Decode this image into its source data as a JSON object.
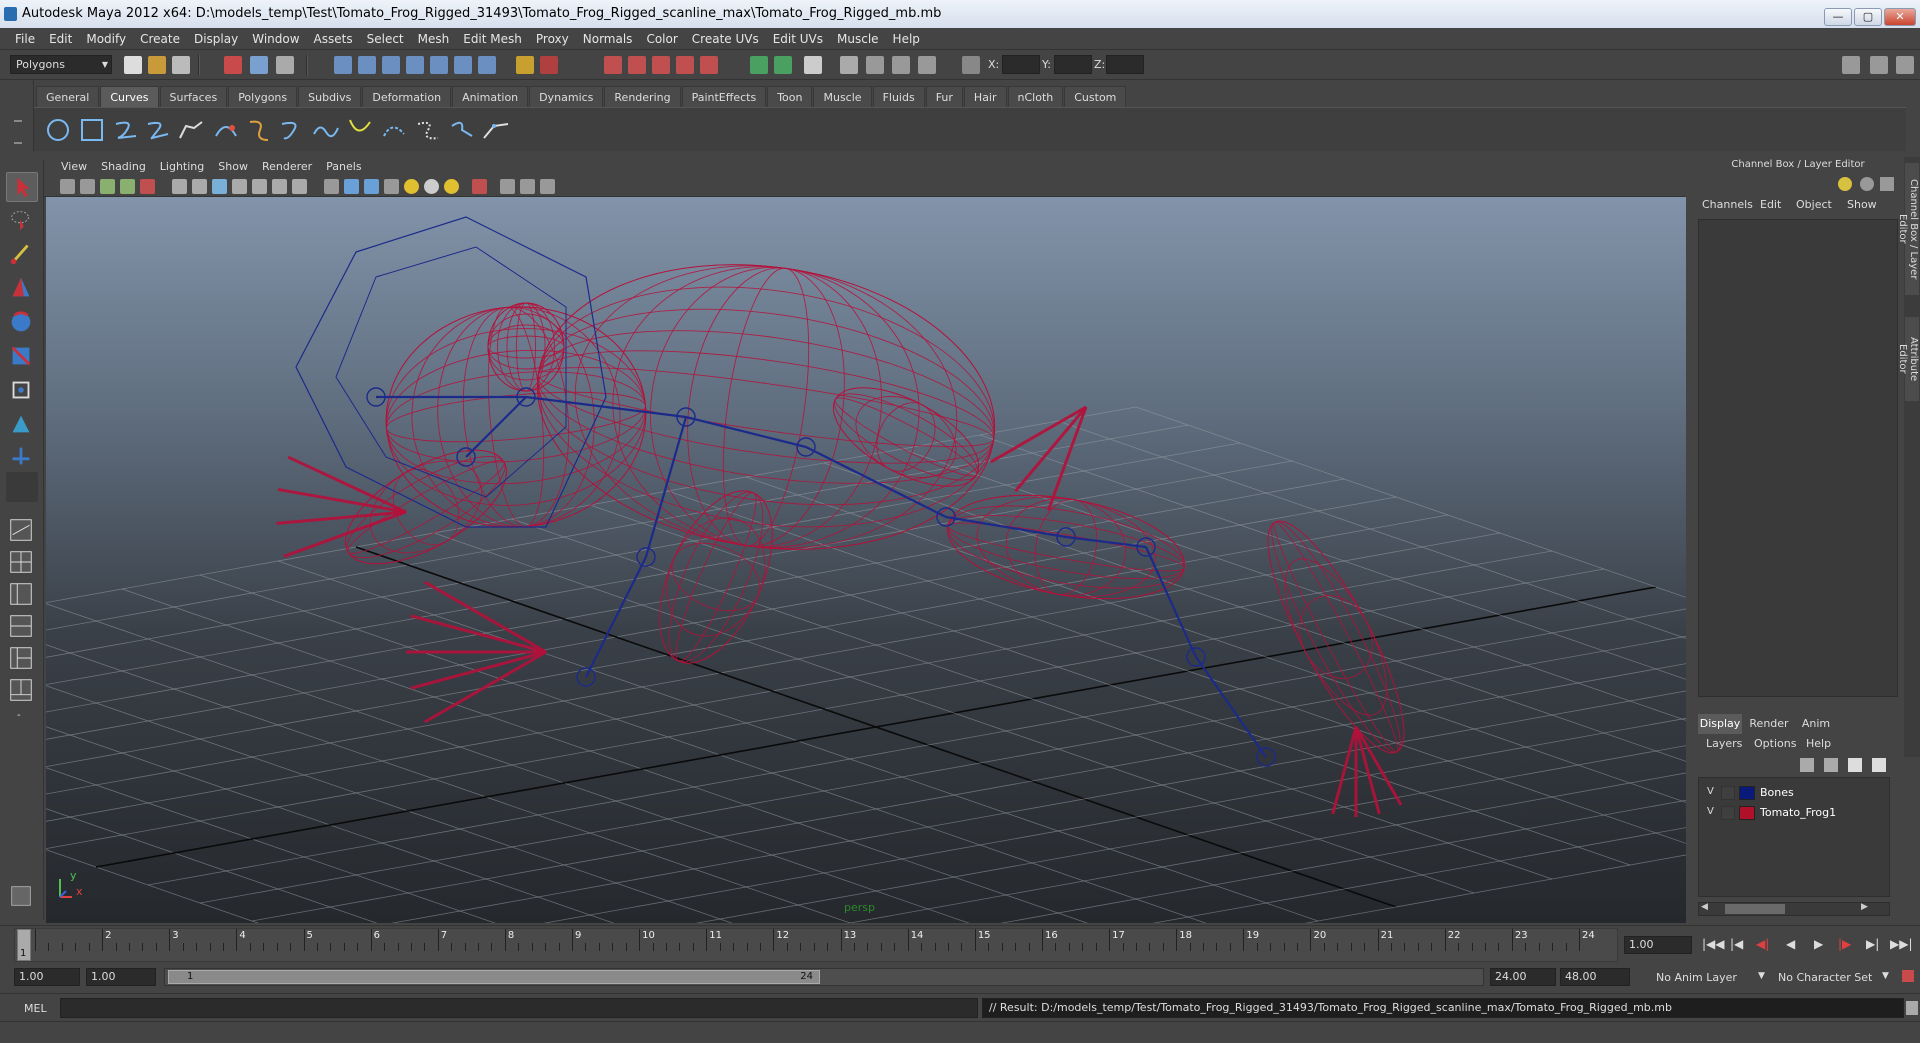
{
  "window": {
    "title": "Autodesk Maya 2012 x64: D:\\models_temp\\Test\\Tomato_Frog_Rigged_31493\\Tomato_Frog_Rigged_scanline_max\\Tomato_Frog_Rigged_mb.mb",
    "min_btn": "—",
    "max_btn": "▢",
    "close_btn": "✕"
  },
  "menubar": [
    "File",
    "Edit",
    "Modify",
    "Create",
    "Display",
    "Window",
    "Assets",
    "Select",
    "Mesh",
    "Edit Mesh",
    "Proxy",
    "Normals",
    "Color",
    "Create UVs",
    "Edit UVs",
    "Muscle",
    "Help"
  ],
  "statusline": {
    "mode": "Polygons",
    "x_label": "X:",
    "y_label": "Y:",
    "z_label": "Z:"
  },
  "shelf": {
    "tabs": [
      "General",
      "Curves",
      "Surfaces",
      "Polygons",
      "Subdivs",
      "Deformation",
      "Animation",
      "Dynamics",
      "Rendering",
      "PaintEffects",
      "Toon",
      "Muscle",
      "Fluids",
      "Fur",
      "Hair",
      "nCloth",
      "Custom"
    ],
    "active_tab": "Curves"
  },
  "viewport": {
    "menu": [
      "View",
      "Shading",
      "Lighting",
      "Show",
      "Renderer",
      "Panels"
    ],
    "camera_label": "persp",
    "axis_y": "y",
    "axis_x": "x",
    "colors": {
      "mesh": "#b5103a",
      "bones": "#1c2a8a",
      "grid": "#9aa0a8"
    }
  },
  "channelbox": {
    "title": "Channel Box / Layer Editor",
    "menu": [
      "Channels",
      "Edit",
      "Object",
      "Show"
    ],
    "side_tab_1": "Channel Box / Layer Editor",
    "side_tab_2": "Attribute Editor"
  },
  "layers": {
    "tabs": [
      "Display",
      "Render",
      "Anim"
    ],
    "active_tab": "Display",
    "menu": [
      "Layers",
      "Options",
      "Help"
    ],
    "rows": [
      {
        "visible": "V",
        "name": "Bones",
        "color": "#0a1a7a"
      },
      {
        "visible": "V",
        "name": "Tomato_Frog1",
        "color": "#b0102a"
      }
    ]
  },
  "timeslider": {
    "labels": [
      "1",
      "2",
      "3",
      "4",
      "5",
      "6",
      "7",
      "8",
      "9",
      "10",
      "11",
      "12",
      "13",
      "14",
      "15",
      "16",
      "17",
      "18",
      "19",
      "20",
      "21",
      "22",
      "23",
      "24"
    ],
    "current_frame_marker": "1",
    "current_time": "1.00"
  },
  "rangeslider": {
    "start_time": "1.00",
    "range_start": "1.00",
    "handle_start": "1",
    "handle_end": "24",
    "range_end": "24.00",
    "end_time": "48.00",
    "anim_layer": "No Anim Layer",
    "character_set": "No Character Set"
  },
  "commandline": {
    "label": "MEL",
    "result": "// Result: D:/models_temp/Test/Tomato_Frog_Rigged_31493/Tomato_Frog_Rigged_scanline_max/Tomato_Frog_Rigged_mb.mb"
  }
}
